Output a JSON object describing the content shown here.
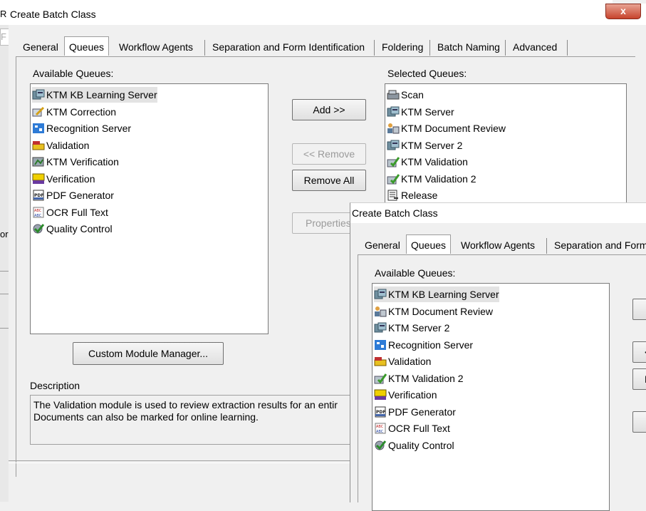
{
  "dialog1": {
    "title": "Create Batch Class",
    "close_symbol": "x",
    "tabs": [
      "General",
      "Queues",
      "Workflow Agents",
      "Separation and Form Identification",
      "Foldering",
      "Batch Naming",
      "Advanced"
    ],
    "available_label": "Available Queues:",
    "available": [
      {
        "label": "KTM KB Learning Server",
        "icon": "server-icon"
      },
      {
        "label": "KTM Correction",
        "icon": "correction-icon"
      },
      {
        "label": "Recognition Server",
        "icon": "recognition-icon"
      },
      {
        "label": "Validation",
        "icon": "validation-icon"
      },
      {
        "label": "KTM Verification",
        "icon": "verification-icon"
      },
      {
        "label": "Verification",
        "icon": "verify-icon"
      },
      {
        "label": "PDF Generator",
        "icon": "pdf-icon"
      },
      {
        "label": "OCR Full Text",
        "icon": "ocr-icon"
      },
      {
        "label": "Quality Control",
        "icon": "quality-icon"
      }
    ],
    "selected_label": "Selected Queues:",
    "selected": [
      {
        "label": "Scan",
        "icon": "scan-icon"
      },
      {
        "label": "KTM Server",
        "icon": "server-icon"
      },
      {
        "label": "KTM Document Review",
        "icon": "review-icon"
      },
      {
        "label": "KTM Server 2",
        "icon": "server-icon"
      },
      {
        "label": "KTM Validation",
        "icon": "ktm-validation-icon"
      },
      {
        "label": "KTM Validation 2",
        "icon": "ktm-validation-icon"
      },
      {
        "label": "Release",
        "icon": "release-icon"
      }
    ],
    "buttons": {
      "add": "Add >>",
      "remove": "<< Remove",
      "remove_all": "Remove All",
      "properties": "Properties",
      "custom_module_manager": "Custom Module Manager..."
    },
    "description_label": "Description",
    "description_text": "The Validation module is used to review extraction results for an entir\nDocuments can also be marked for online learning."
  },
  "background_fragments": {
    "left_title_glyph": "R",
    "left_edge_f": "F",
    "left_edge_or": "or"
  },
  "dialog2": {
    "title": "Create Batch Class",
    "tabs": [
      "General",
      "Queues",
      "Workflow Agents",
      "Separation and Form"
    ],
    "available_label": "Available Queues:",
    "available": [
      {
        "label": "KTM KB Learning Server",
        "icon": "server-icon"
      },
      {
        "label": "KTM Document Review",
        "icon": "review-icon"
      },
      {
        "label": "KTM Server 2",
        "icon": "server-icon"
      },
      {
        "label": "Recognition Server",
        "icon": "recognition-icon"
      },
      {
        "label": "Validation",
        "icon": "validation-icon"
      },
      {
        "label": "KTM Validation 2",
        "icon": "ktm-validation-icon"
      },
      {
        "label": "Verification",
        "icon": "verify-icon"
      },
      {
        "label": "PDF Generator",
        "icon": "pdf-icon"
      },
      {
        "label": "OCR Full Text",
        "icon": "ocr-icon"
      },
      {
        "label": "Quality Control",
        "icon": "quality-icon"
      }
    ],
    "button_fragments": [
      "<",
      "F"
    ]
  }
}
